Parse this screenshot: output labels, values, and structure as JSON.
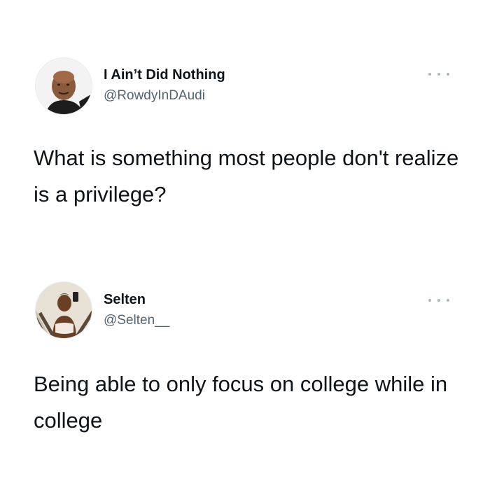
{
  "tweets": [
    {
      "display_name": "I Ain’t Did Nothing",
      "handle": "@RowdyInDAudi",
      "text": "What is something most people don't realize is a privilege?"
    },
    {
      "display_name": "Selten",
      "handle": "@Selten__",
      "text": "Being able to only focus on college while in college"
    }
  ],
  "icons": {
    "more": "more-options-icon",
    "avatar": "avatar"
  },
  "colors": {
    "background": "#ffffff",
    "text": "#0f1419",
    "handle": "#536471",
    "more_dots": "#aab8c2"
  }
}
